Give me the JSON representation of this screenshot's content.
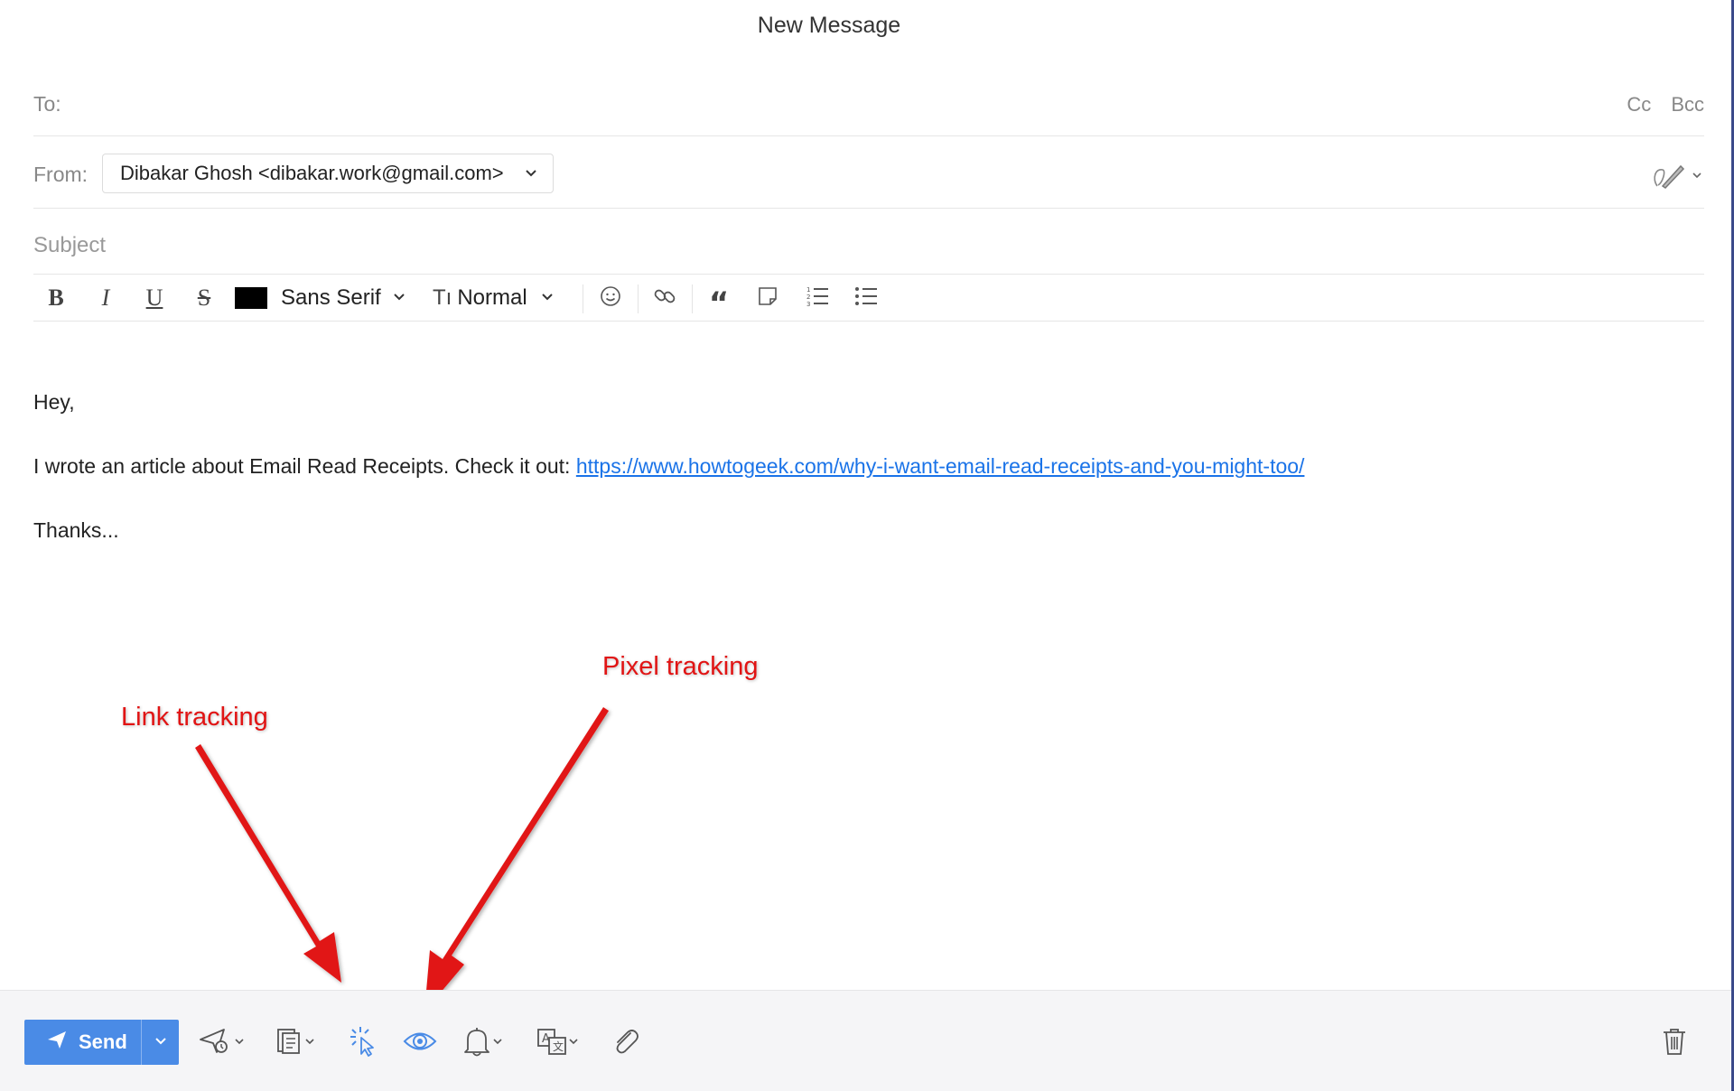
{
  "window": {
    "title": "New Message"
  },
  "to": {
    "label": "To:",
    "cc_label": "Cc",
    "bcc_label": "Bcc"
  },
  "from": {
    "label": "From:",
    "value": "Dibakar Ghosh <dibakar.work@gmail.com>"
  },
  "subject": {
    "placeholder": "Subject"
  },
  "toolbar": {
    "bold_label": "B",
    "italic_label": "I",
    "underline_label": "U",
    "strike_label": "S",
    "text_color": "#000000",
    "font_family": "Sans Serif",
    "font_size_prefix": "Tı",
    "font_size": "Normal",
    "icons": [
      "bold-icon",
      "italic-icon",
      "underline-icon",
      "strikethrough-icon",
      "text-color-swatch",
      "font-family-select",
      "font-size-select",
      "emoji-icon",
      "link-icon",
      "quote-icon",
      "sticky-note-icon",
      "numbered-list-icon",
      "bulleted-list-icon"
    ]
  },
  "message": {
    "greeting": "Hey,",
    "line_text": "I wrote an article about Email Read Receipts. Check it out: ",
    "link": "https://www.howtogeek.com/why-i-want-email-read-receipts-and-you-might-too/",
    "closing": "Thanks..."
  },
  "annotations": {
    "link_tracking": "Link tracking",
    "pixel_tracking": "Pixel tracking",
    "color": "#e11414"
  },
  "footer": {
    "send_label": "Send",
    "send_color": "#4a8be6",
    "icons": [
      "send-later-icon",
      "templates-icon",
      "link-tracking-icon",
      "pixel-tracking-icon",
      "reminder-bell-icon",
      "translate-icon",
      "attach-icon",
      "delete-icon"
    ]
  }
}
